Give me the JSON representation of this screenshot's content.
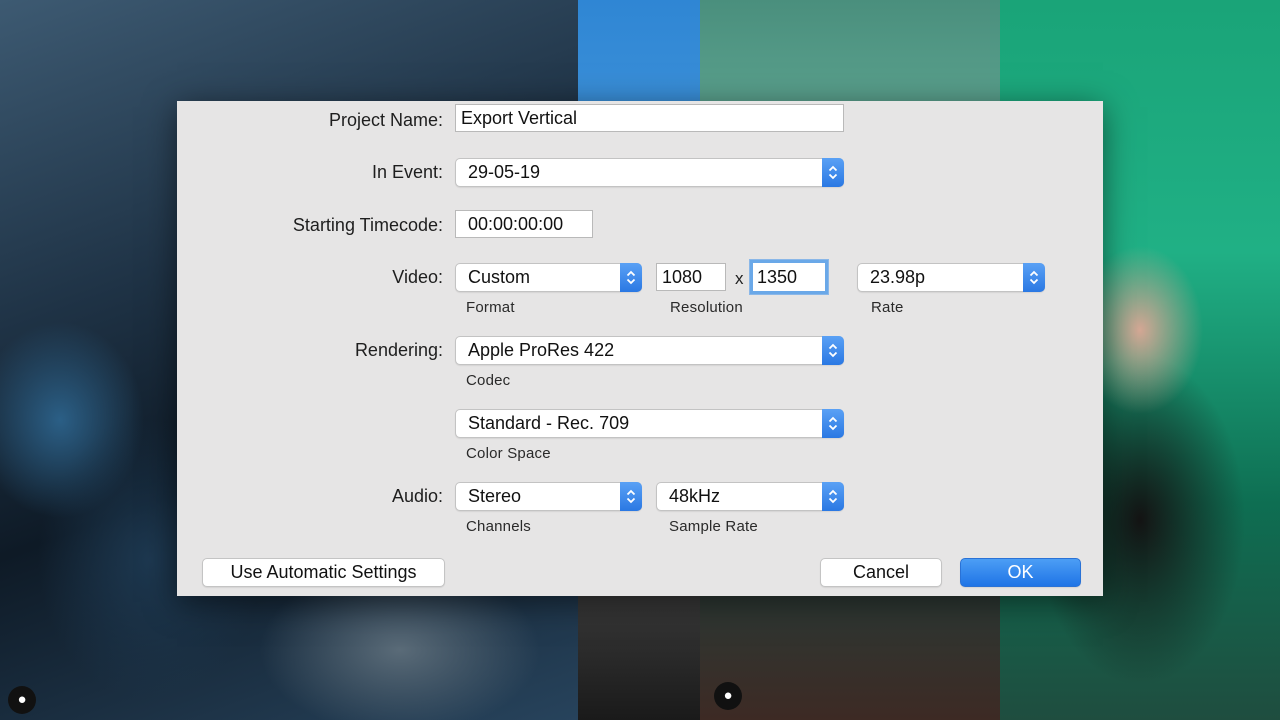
{
  "dialog": {
    "project_name": {
      "label": "Project Name:",
      "value": "Export Vertical"
    },
    "in_event": {
      "label": "In Event:",
      "value": "29-05-19"
    },
    "starting_timecode": {
      "label": "Starting Timecode:",
      "value": "00:00:00:00"
    },
    "video": {
      "label": "Video:",
      "format": {
        "value": "Custom",
        "caption": "Format"
      },
      "resolution": {
        "width": "1080",
        "separator": "x",
        "height": "1350",
        "caption": "Resolution"
      },
      "rate": {
        "value": "23.98p",
        "caption": "Rate"
      }
    },
    "rendering": {
      "label": "Rendering:",
      "codec": {
        "value": "Apple ProRes 422",
        "caption": "Codec"
      },
      "color_space": {
        "value": "Standard - Rec. 709",
        "caption": "Color Space"
      }
    },
    "audio": {
      "label": "Audio:",
      "channels": {
        "value": "Stereo",
        "caption": "Channels"
      },
      "sample_rate": {
        "value": "48kHz",
        "caption": "Sample Rate"
      }
    },
    "buttons": {
      "automatic": "Use Automatic Settings",
      "cancel": "Cancel",
      "ok": "OK"
    }
  },
  "colors": {
    "accent": "#2a78e3",
    "dialog_bg": "#e6e5e5",
    "focus_ring": "#6aa8e8"
  },
  "icons": [
    "updown-chevron-icon",
    "user-icon"
  ]
}
